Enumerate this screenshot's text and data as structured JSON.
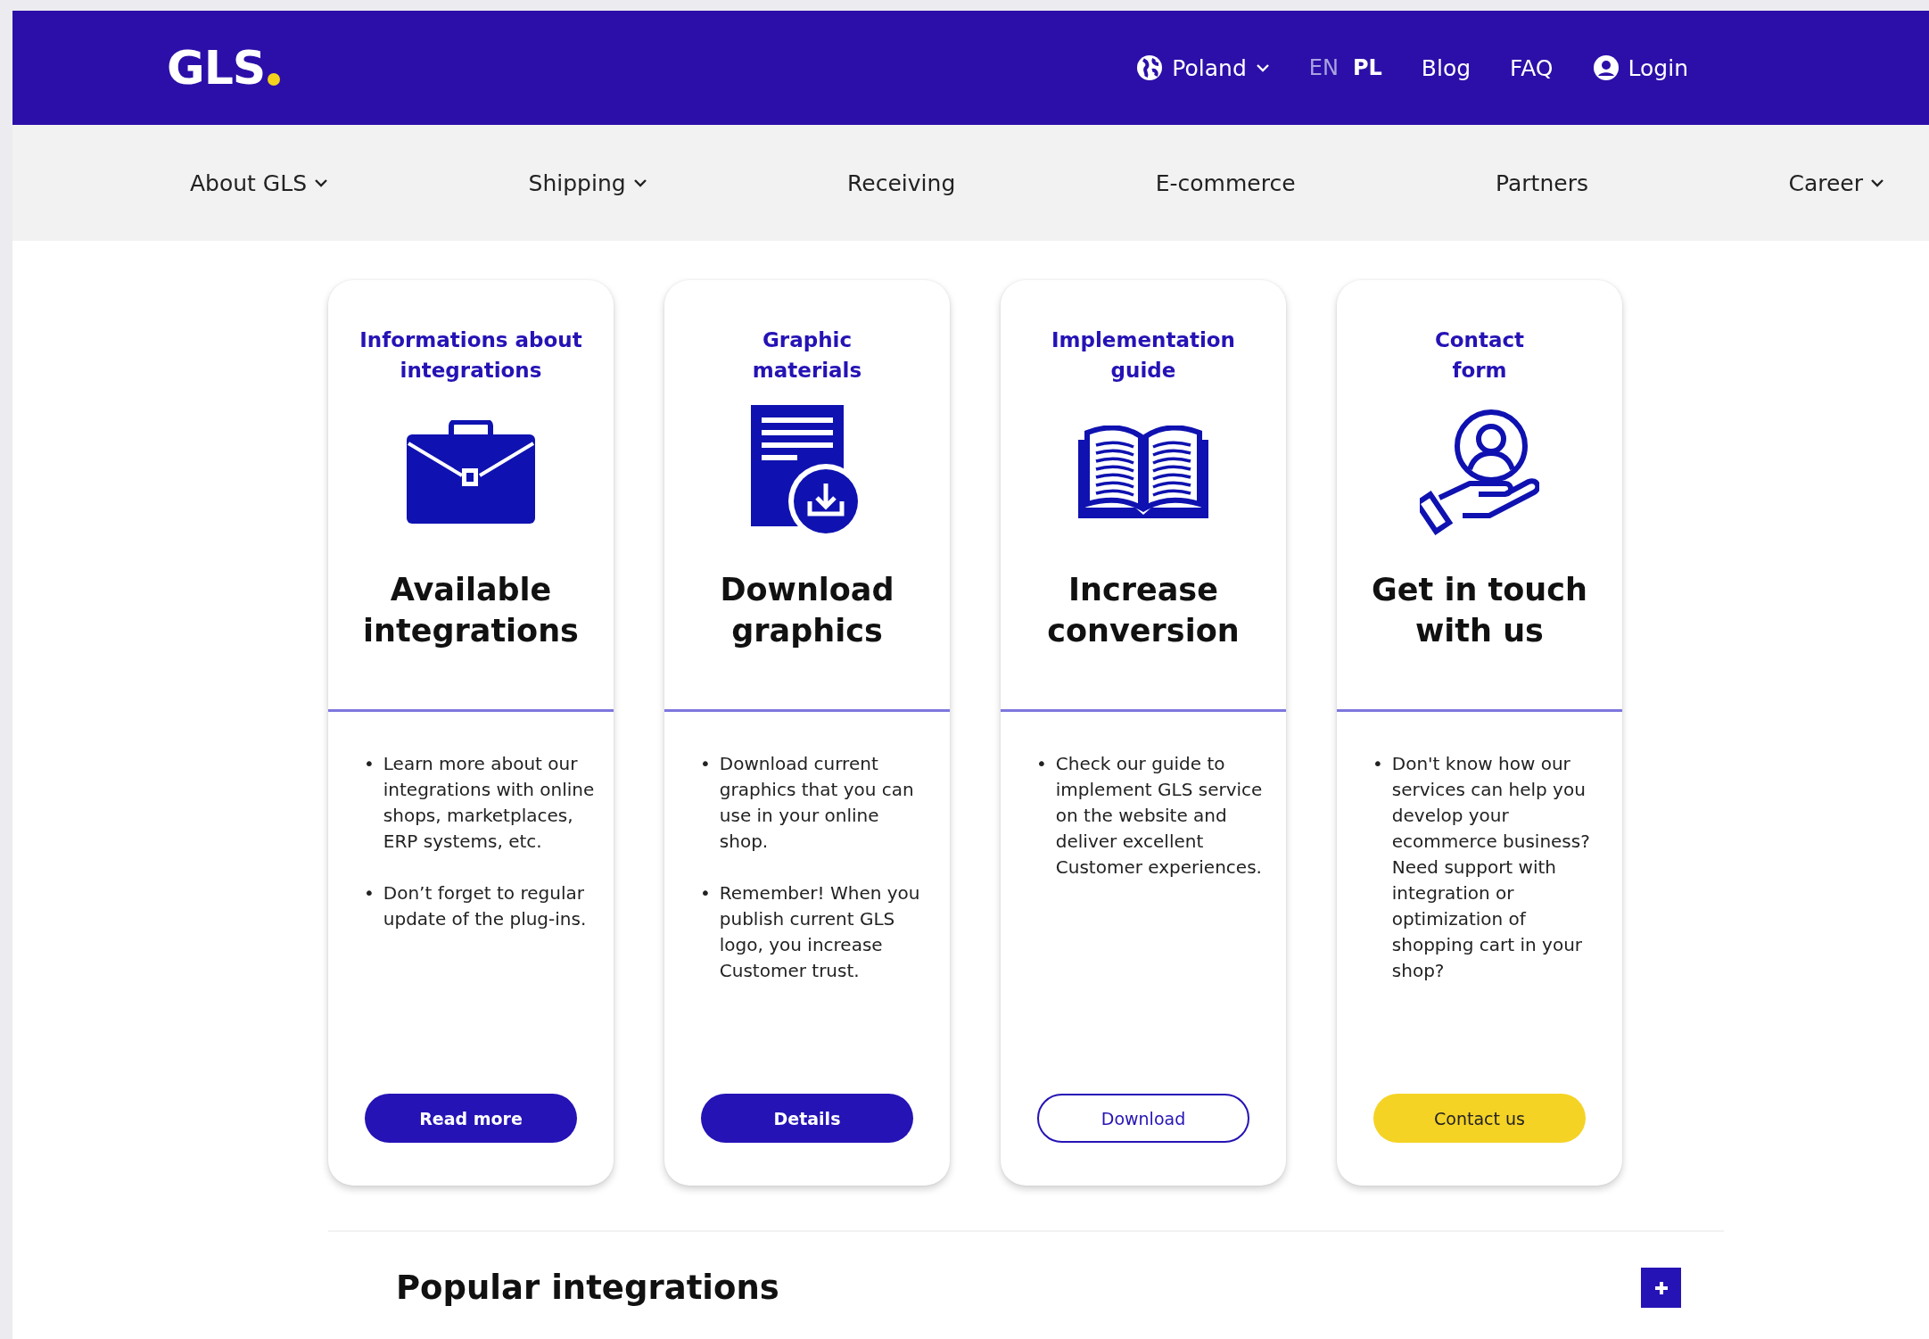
{
  "header": {
    "logo": "GLS",
    "country": "Poland",
    "languages": [
      {
        "label": "EN",
        "selected": false
      },
      {
        "label": "PL",
        "selected": true
      }
    ],
    "links": [
      "Blog",
      "FAQ"
    ],
    "login": "Login"
  },
  "nav": [
    {
      "label": "About GLS",
      "dropdown": true
    },
    {
      "label": "Shipping",
      "dropdown": true
    },
    {
      "label": "Receiving",
      "dropdown": false
    },
    {
      "label": "E-commerce",
      "dropdown": false
    },
    {
      "label": "Partners",
      "dropdown": false
    },
    {
      "label": "Career",
      "dropdown": true
    }
  ],
  "cards": [
    {
      "title": "Informations about\nintegrations",
      "marker": "•",
      "heading": "Available integrations",
      "bullets": [
        "Learn more about our integrations with online shops, marketplaces, ERP systems, etc.",
        "Don’t forget to regular update of the plug-ins."
      ],
      "button": {
        "label": "Read more",
        "kind": "primary"
      }
    },
    {
      "title": "Graphic\nmaterials",
      "marker": "•",
      "heading": "Download graphics",
      "bullets": [
        "Download current graphics that you can use in your online shop.",
        "Remember! When you publish current GLS logo, you increase Customer trust."
      ],
      "button": {
        "label": "Details",
        "kind": "primary"
      }
    },
    {
      "title": "Implementation\nguide",
      "marker": "•",
      "heading": "Increase conversion",
      "bullets": [
        "Check our guide to implement GLS service on the website and deliver excellent Customer experiences."
      ],
      "button": {
        "label": "Download",
        "kind": "outline"
      }
    },
    {
      "title": "Contact\nform",
      "marker": "•",
      "heading": "Get in touch with us",
      "bullets": [
        "Don't know how our services can help you develop your ecommerce business? Need support with integration or optimization of shopping cart in your shop?"
      ],
      "button": {
        "label": "Contact us",
        "kind": "yellow"
      }
    }
  ],
  "section": {
    "title": "Popular integrations",
    "expanded": false
  }
}
